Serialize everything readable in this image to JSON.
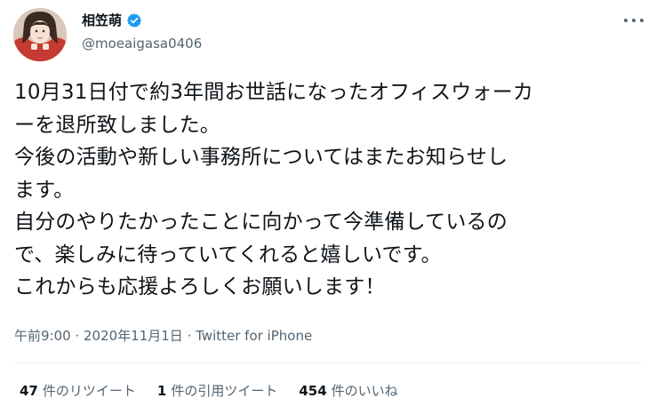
{
  "user": {
    "display_name": "相笠萌",
    "handle": "@moeaigasa0406",
    "verified": true,
    "avatar_icon": "profile-photo"
  },
  "menu_icon": "more-horizontal-icon",
  "tweet": {
    "lines": [
      "10月31日付で約3年間お世話になったオフィスウォーカ",
      "ーを退所致しました。",
      "今後の活動や新しい事務所についてはまたお知らせし",
      "ます。",
      "自分のやりたかったことに向かって今準備しているの",
      "で、楽しみに待っていてくれると嬉しいです。",
      "これからも応援よろしくお願いします！"
    ]
  },
  "meta": {
    "time": "午前9:00",
    "sep1": " · ",
    "date": "2020年11月1日",
    "sep2": " · ",
    "client": "Twitter for iPhone"
  },
  "stats": {
    "retweets": {
      "count": "47",
      "label": "件のリツイート"
    },
    "quotes": {
      "count": "1",
      "label": "件の引用ツイート"
    },
    "likes": {
      "count": "454",
      "label": "件のいいね"
    }
  },
  "colors": {
    "verified": "#1d9bf0",
    "text": "#0f1419",
    "secondary": "#536471",
    "divider": "#eff3f4"
  }
}
